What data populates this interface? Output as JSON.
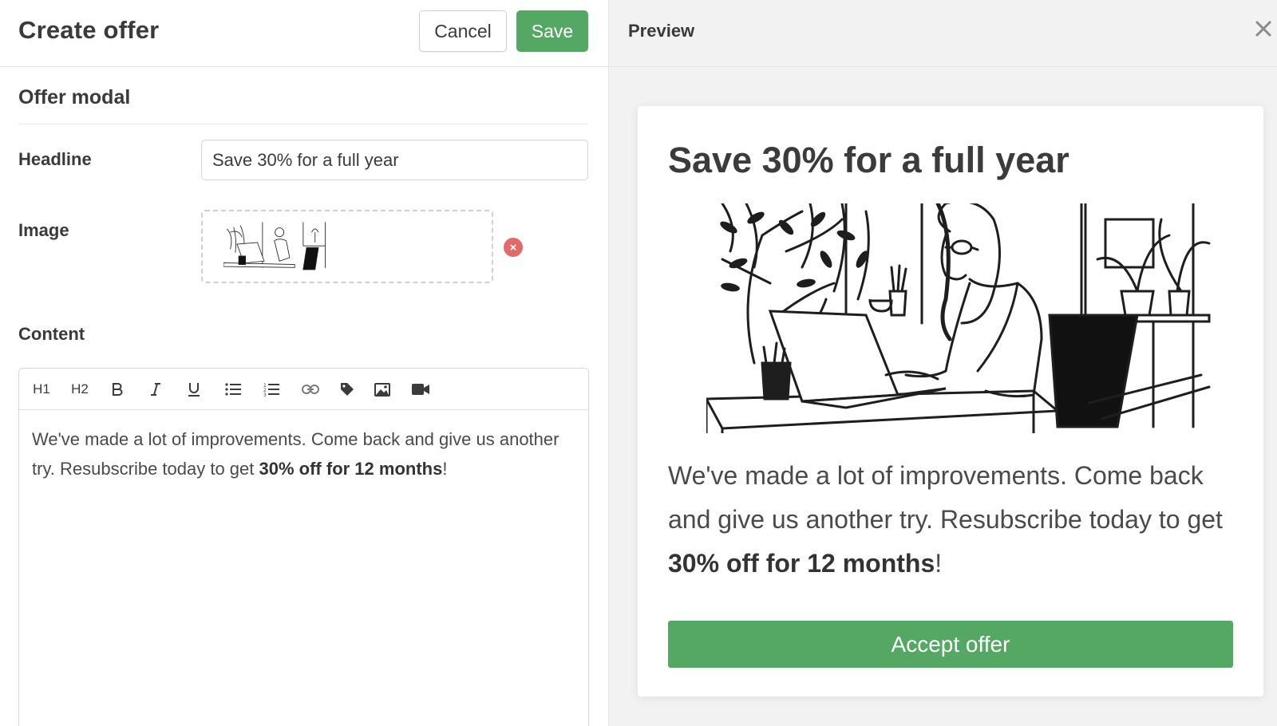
{
  "editor": {
    "title": "Create offer",
    "cancel_label": "Cancel",
    "save_label": "Save",
    "section_title": "Offer modal",
    "headline_label": "Headline",
    "headline_value": "Save 30% for a full year",
    "image_label": "Image",
    "content_label": "Content",
    "toolbar": {
      "h1": "H1",
      "h2": "H2",
      "icons": [
        "bold-icon",
        "italic-icon",
        "underline-icon",
        "bullet-list-icon",
        "numbered-list-icon",
        "link-icon",
        "tag-icon",
        "image-icon",
        "video-icon"
      ]
    },
    "content": {
      "text_before": "We've made a lot of improvements. Come back and give us another try. Resubscribe today to get ",
      "text_bold": "30% off for 12 months",
      "text_after": "!"
    }
  },
  "preview": {
    "title": "Preview",
    "modal": {
      "headline": "Save 30% for a full year",
      "body_before": "We've made a lot of improvements. Come back and give us another try. Resubscribe today to get ",
      "body_bold": "30% off for 12 months",
      "body_after": "!",
      "accept_label": "Accept offer"
    }
  },
  "colors": {
    "primary_green": "#55a863",
    "remove_red": "#e06a6a",
    "preview_bg": "#f2f2f2"
  }
}
